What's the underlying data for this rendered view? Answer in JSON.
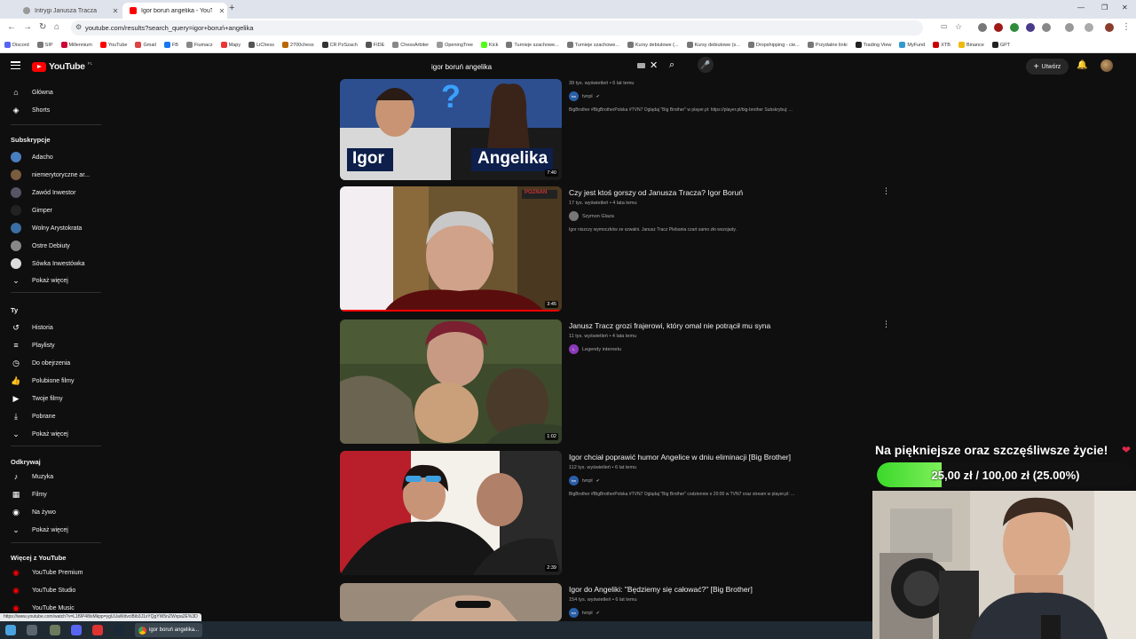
{
  "browser": {
    "tabs": [
      {
        "title": "Intrygi Janusza Tracza",
        "active": false
      },
      {
        "title": "Igor boruń angelika - YouTube",
        "active": true
      }
    ],
    "url": "youtube.com/results?search_query=igor+boruń+angelika",
    "bookmarks": [
      "Discord",
      "SIP",
      "Millennium",
      "YouTube",
      "Gmail",
      "FB",
      "Fiumacz",
      "Mapy",
      "LiChess",
      "2700chess",
      "CR PzSzach",
      "FIDE",
      "ChessArbiter",
      "OpeningTree",
      "Kick",
      "Turnieje szachowe...",
      "Turnieje szachowe...",
      "Kursy debiutowe (...",
      "Kursy debiutowe (s...",
      "Dropshipping - cie...",
      "Przydatne linki",
      "Trading View",
      "MyFund",
      "XTB",
      "Binance",
      "GPT"
    ]
  },
  "yt": {
    "logo": "YouTube",
    "country": "PL",
    "search_query": "igor boruń angelika",
    "create_label": "Utwórz"
  },
  "sidebar": {
    "main": [
      {
        "label": "Główna",
        "icon": "home-icon",
        "glyph": "⌂"
      },
      {
        "label": "Shorts",
        "icon": "shorts-icon",
        "glyph": "◈"
      }
    ],
    "subs_heading": "Subskrypcje",
    "subs": [
      {
        "label": "Adacho",
        "color": "#4a7fbf"
      },
      {
        "label": "niemerytoryczne ar...",
        "color": "#7a5c3e"
      },
      {
        "label": "Zawód Inwestor",
        "color": "#556"
      },
      {
        "label": "Gimper",
        "color": "#222"
      },
      {
        "label": "Wolny Arystokrata",
        "color": "#3a6ea5"
      },
      {
        "label": "Ostre Debiuty",
        "color": "#888"
      },
      {
        "label": "Sówka Inwestówka",
        "color": "#ddd"
      },
      {
        "label": "Pokaż więcej",
        "color": ""
      }
    ],
    "you_heading": "Ty",
    "you": [
      {
        "label": "Historia",
        "glyph": "↺"
      },
      {
        "label": "Playlisty",
        "glyph": "≡"
      },
      {
        "label": "Do obejrzenia",
        "glyph": "◷"
      },
      {
        "label": "Polubione filmy",
        "glyph": "👍"
      },
      {
        "label": "Twoje filmy",
        "glyph": "▶"
      },
      {
        "label": "Pobrane",
        "glyph": "⤓"
      },
      {
        "label": "Pokaż więcej",
        "glyph": "⌄"
      }
    ],
    "explore_heading": "Odkrywaj",
    "explore": [
      {
        "label": "Muzyka",
        "glyph": "♪"
      },
      {
        "label": "Filmy",
        "glyph": "▦"
      },
      {
        "label": "Na żywo",
        "glyph": "◉"
      },
      {
        "label": "Pokaż więcej",
        "glyph": "⌄"
      }
    ],
    "more_heading": "Więcej z YouTube",
    "more": [
      {
        "label": "YouTube Premium"
      },
      {
        "label": "YouTube Studio"
      },
      {
        "label": "YouTube Music"
      }
    ]
  },
  "results": [
    {
      "title": "",
      "meta": "39 tys. wyświetleń • 6 lat temu",
      "channel": "tvnpl",
      "verified": true,
      "desc": "BigBrother #BigBrotherPolska #TVN7 Oglądaj \"Big Brother\" w player.pl: https://player.pl/big-brother Subskrybuj: ...",
      "duration": "7:40",
      "thumb_text_left": "Igor",
      "thumb_text_right": "Angelika",
      "progress": 0
    },
    {
      "title": "Czy jest ktoś gorszy od Janusza Tracza? Igor Boruń",
      "meta": "17 tys. wyświetleń • 4 lata temu",
      "channel": "Szymon Glaza",
      "verified": false,
      "desc": "Igor niszczy wymoczków ze szwalni. Janusz Tracz Plebania czart samo zło wszojady.",
      "duration": "3:45",
      "thumb_badge": "POZNAN",
      "progress": 1.0
    },
    {
      "title": "Janusz Tracz grozi frajerowi, który omal nie potrącił mu syna",
      "meta": "11 tys. wyświetleń • 4 lata temu",
      "channel": "Legendy internetu",
      "verified": false,
      "desc": "",
      "duration": "1:02",
      "progress": 0
    },
    {
      "title": "Igor chciał poprawić humor Angelice w dniu eliminacji [Big Brother]",
      "meta": "112 tys. wyświetleń • 6 lat temu",
      "channel": "tvnpl",
      "verified": true,
      "desc": "BigBrother #BigBrotherPolska #TVN7 Oglądaj \"Big Brother\" codziennie o 20:00 w TVN7 oraz stream w player.pl: ...",
      "duration": "2:39",
      "progress": 0
    },
    {
      "title": "Igor do Angeliki: \"Będziemy się całować?\" [Big Brother]",
      "meta": "154 tys. wyświetleń • 6 lat temu",
      "channel": "tvnpl",
      "verified": true,
      "desc": "",
      "duration": "",
      "progress": 0
    }
  ],
  "overlay": {
    "title": "Na piękniejsze oraz szczęśliwsze życie!",
    "goal_text": "25,00 zł / 100,00 zł (25.00%)",
    "goal_progress": 0.25
  },
  "status_url": "https://www.youtube.com/watch?v=L1f9P48lxMkpp=ygUUaWdvciBib3J1xYQgYW5nZWxpa2E%3D",
  "taskbar": {
    "active_label": "igor boruń angelika..."
  }
}
